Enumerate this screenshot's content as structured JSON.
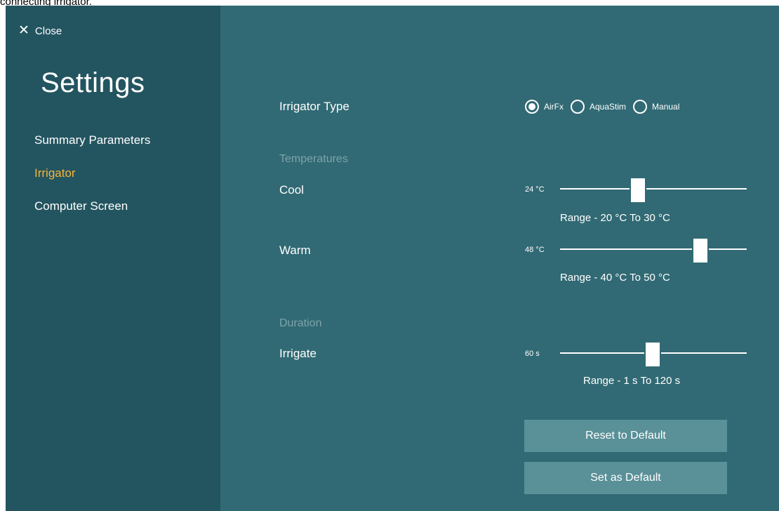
{
  "caption": "connecting irrigator.",
  "sidebar": {
    "close_label": "Close",
    "title": "Settings",
    "items": [
      {
        "label": "Summary Parameters",
        "active": false
      },
      {
        "label": "Irrigator",
        "active": true
      },
      {
        "label": "Computer Screen",
        "active": false
      }
    ]
  },
  "irrigator_type": {
    "label": "Irrigator Type",
    "options": [
      "AirFx",
      "AquaStim",
      "Manual"
    ],
    "selected": "AirFx"
  },
  "temperatures": {
    "section_label": "Temperatures",
    "cool": {
      "label": "Cool",
      "value_text": "24 °C",
      "value": 24,
      "min": 20,
      "max": 30,
      "range_text": "Range - 20 °C To 30 °C"
    },
    "warm": {
      "label": "Warm",
      "value_text": "48 °C",
      "value": 48,
      "min": 40,
      "max": 50,
      "range_text": "Range - 40 °C To 50 °C"
    }
  },
  "duration": {
    "section_label": "Duration",
    "irrigate": {
      "label": "Irrigate",
      "value_text": "60 s",
      "value": 60,
      "min": 1,
      "max": 120,
      "range_text": "Range - 1 s To 120 s"
    }
  },
  "buttons": {
    "reset_label": "Reset to Default",
    "set_label": "Set as Default"
  },
  "colors": {
    "sidebar_bg": "#235560",
    "main_bg": "#316a74",
    "active_nav": "#f4b33b",
    "section_label": "#7fa3aa",
    "button_bg": "#5a9098"
  },
  "icons": {
    "close": "close-icon"
  }
}
